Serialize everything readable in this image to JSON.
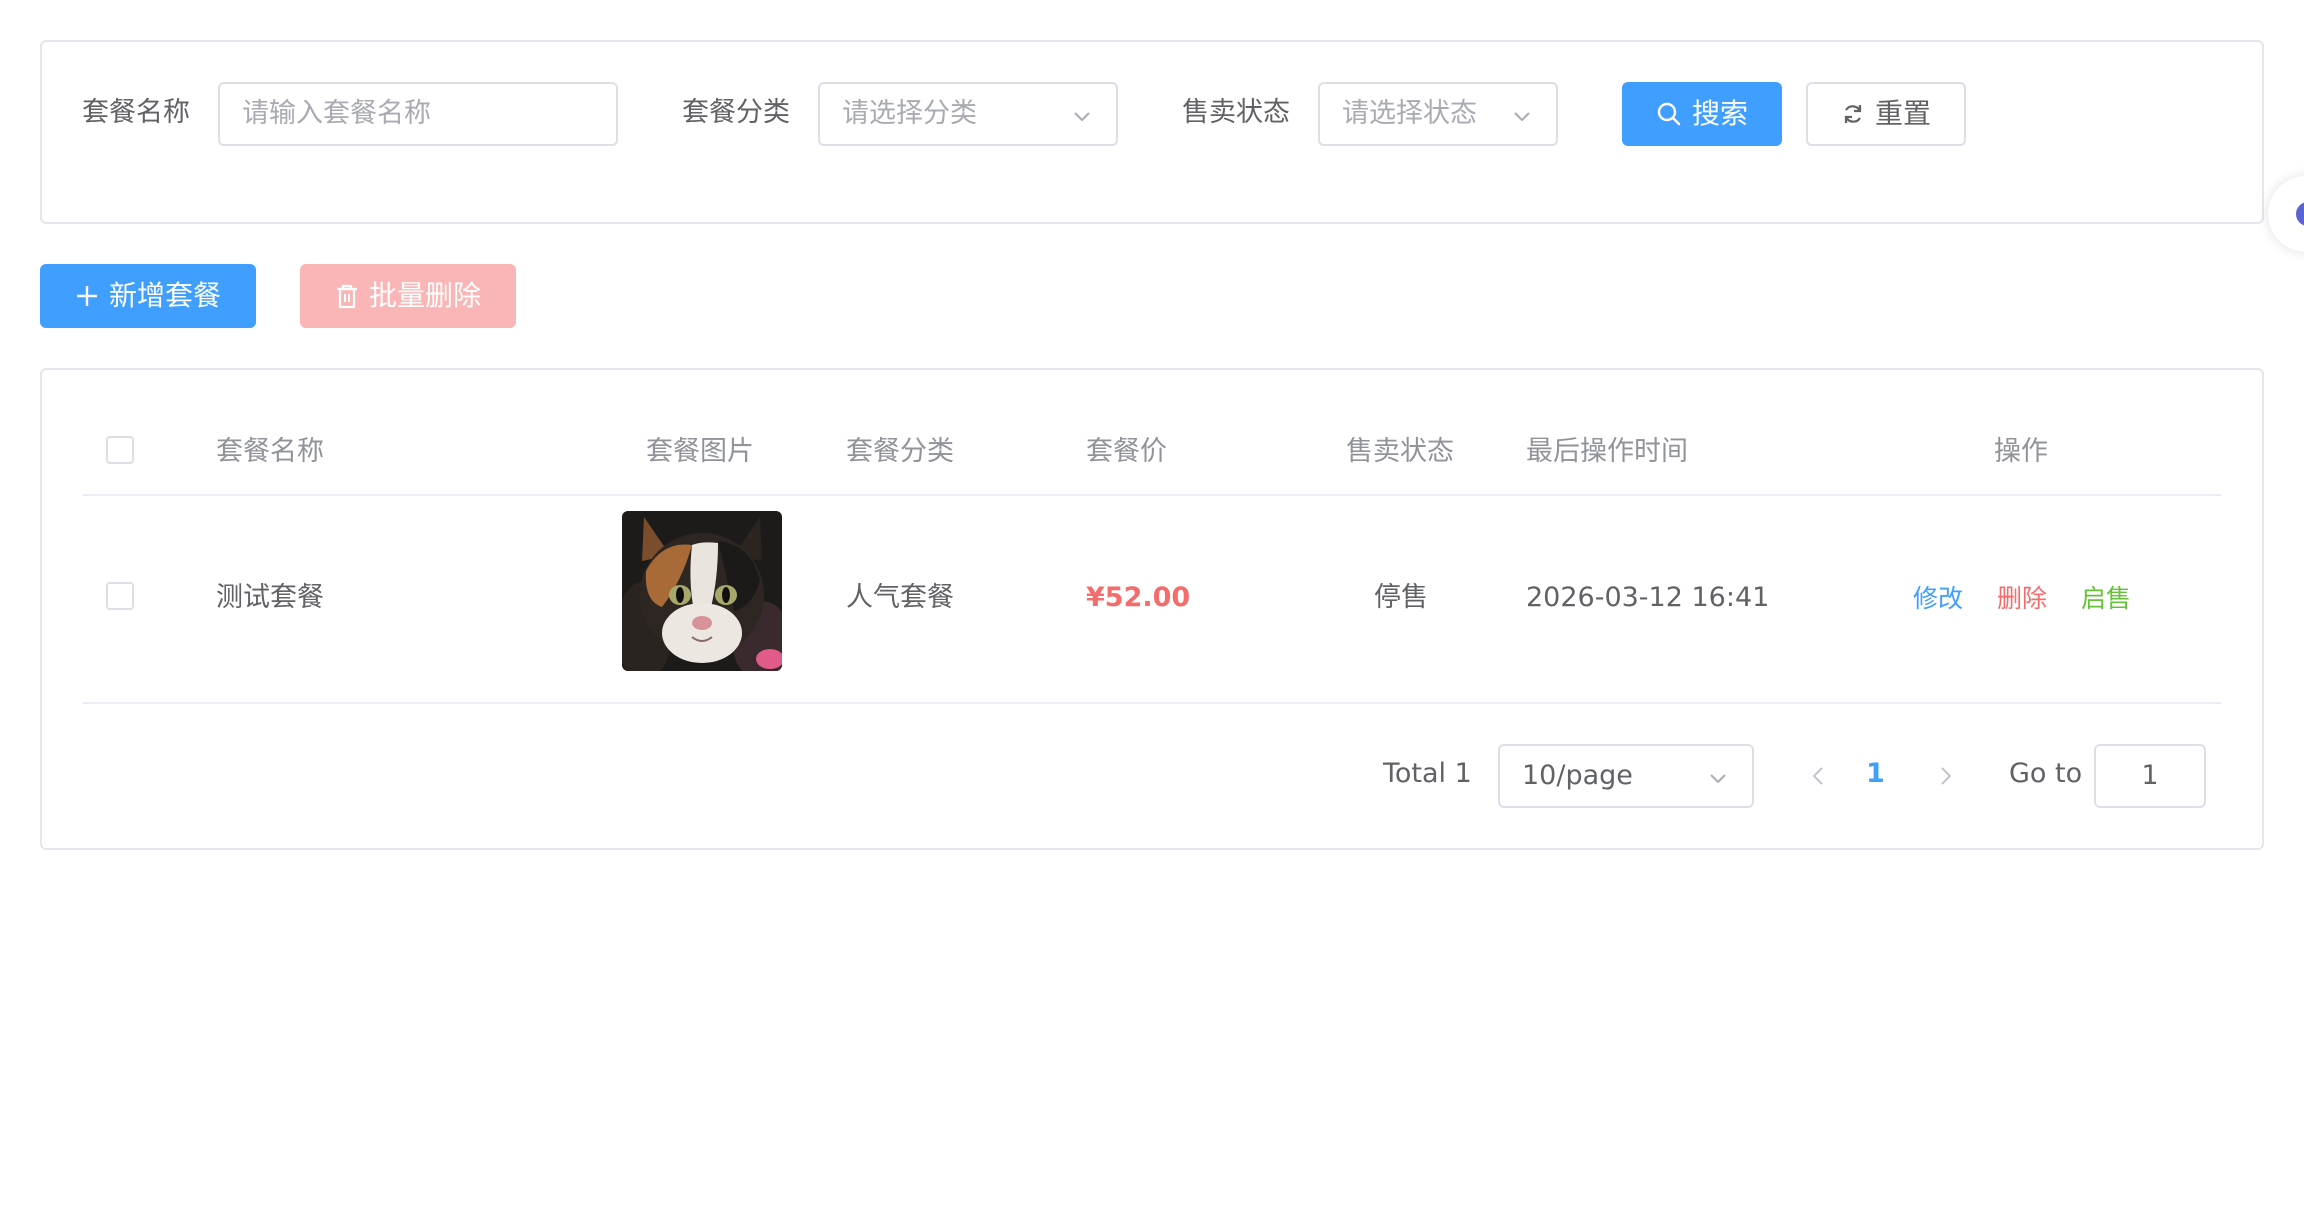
{
  "search": {
    "name_label": "套餐名称",
    "name_placeholder": "请输入套餐名称",
    "category_label": "套餐分类",
    "category_placeholder": "请选择分类",
    "status_label": "售卖状态",
    "status_placeholder": "请选择状态",
    "search_button": "搜索",
    "reset_button": "重置"
  },
  "toolbar": {
    "add_button": "新增套餐",
    "batch_delete_button": "批量删除"
  },
  "table": {
    "headers": {
      "name": "套餐名称",
      "image": "套餐图片",
      "category": "套餐分类",
      "price": "套餐价",
      "status": "售卖状态",
      "updated": "最后操作时间",
      "actions": "操作"
    },
    "rows": [
      {
        "name": "测试套餐",
        "category": "人气套餐",
        "price": "¥52.00",
        "status": "停售",
        "updated": "2026-03-12 16:41",
        "actions": {
          "edit": "修改",
          "delete": "删除",
          "enable": "启售"
        }
      }
    ]
  },
  "pagination": {
    "total": "Total 1",
    "page_size": "10/page",
    "current_page": "1",
    "goto_label": "Go to",
    "goto_value": "1"
  },
  "colors": {
    "primary": "#409eff",
    "danger": "#f56c6c",
    "success": "#67c23a",
    "disabled_danger": "#fab6b6"
  }
}
